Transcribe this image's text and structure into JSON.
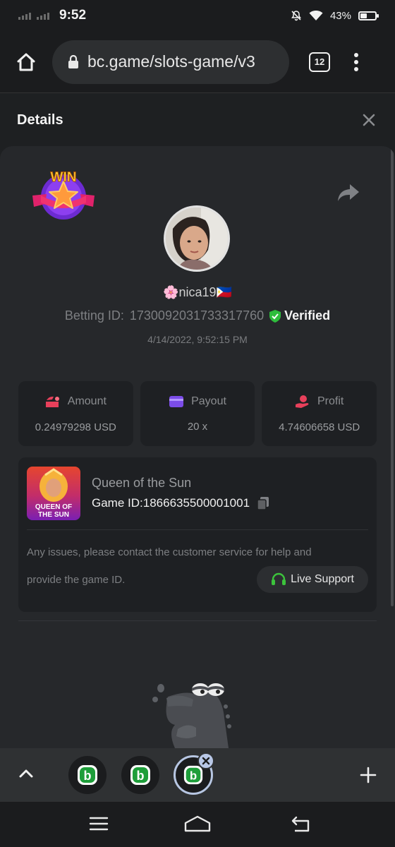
{
  "status_bar": {
    "time": "9:52",
    "battery_percent": "43%",
    "battery_level": 0.43,
    "icons": [
      "signal-bars-icon",
      "signal-bars-icon",
      "mute-icon",
      "wifi-icon",
      "battery-icon"
    ]
  },
  "browser": {
    "url": "bc.game/slots-game/v3",
    "tab_count": "12",
    "icons": [
      "home-icon",
      "lock-icon",
      "tabs-icon",
      "overflow-menu-icon"
    ]
  },
  "details": {
    "title": "Details",
    "win_badge_text": "WIN",
    "username": "🌸nica19🇵🇭",
    "betting_label": "Betting ID:",
    "betting_id": "1730092031733317760",
    "verified_label": "Verified",
    "date": "4/14/2022, 9:52:15 PM"
  },
  "stats": [
    {
      "label": "Amount",
      "value": "0.24979298 USD",
      "icon": "wallet-icon",
      "color": "#e8405b"
    },
    {
      "label": "Payout",
      "value": "20 x",
      "icon": "card-icon",
      "color": "#7b4ce8"
    },
    {
      "label": "Profit",
      "value": "4.74606658 USD",
      "icon": "hand-coin-icon",
      "color": "#e8405b"
    }
  ],
  "game": {
    "name": "Queen of the Sun",
    "game_id_label": "Game ID:",
    "game_id": "1866635500001001",
    "thumb_text_1": "QUEEN OF",
    "thumb_text_2": "THE SUN",
    "issue_line_1": "Any issues, please contact the customer service for help and",
    "issue_line_2": "provide the game ID.",
    "live_support_label": "Live Support"
  },
  "colors": {
    "background": "#1e2022",
    "panel": "#26282b",
    "card": "#1e2023",
    "verified_green": "#2ebd3c",
    "support_green": "#3cc33c"
  }
}
